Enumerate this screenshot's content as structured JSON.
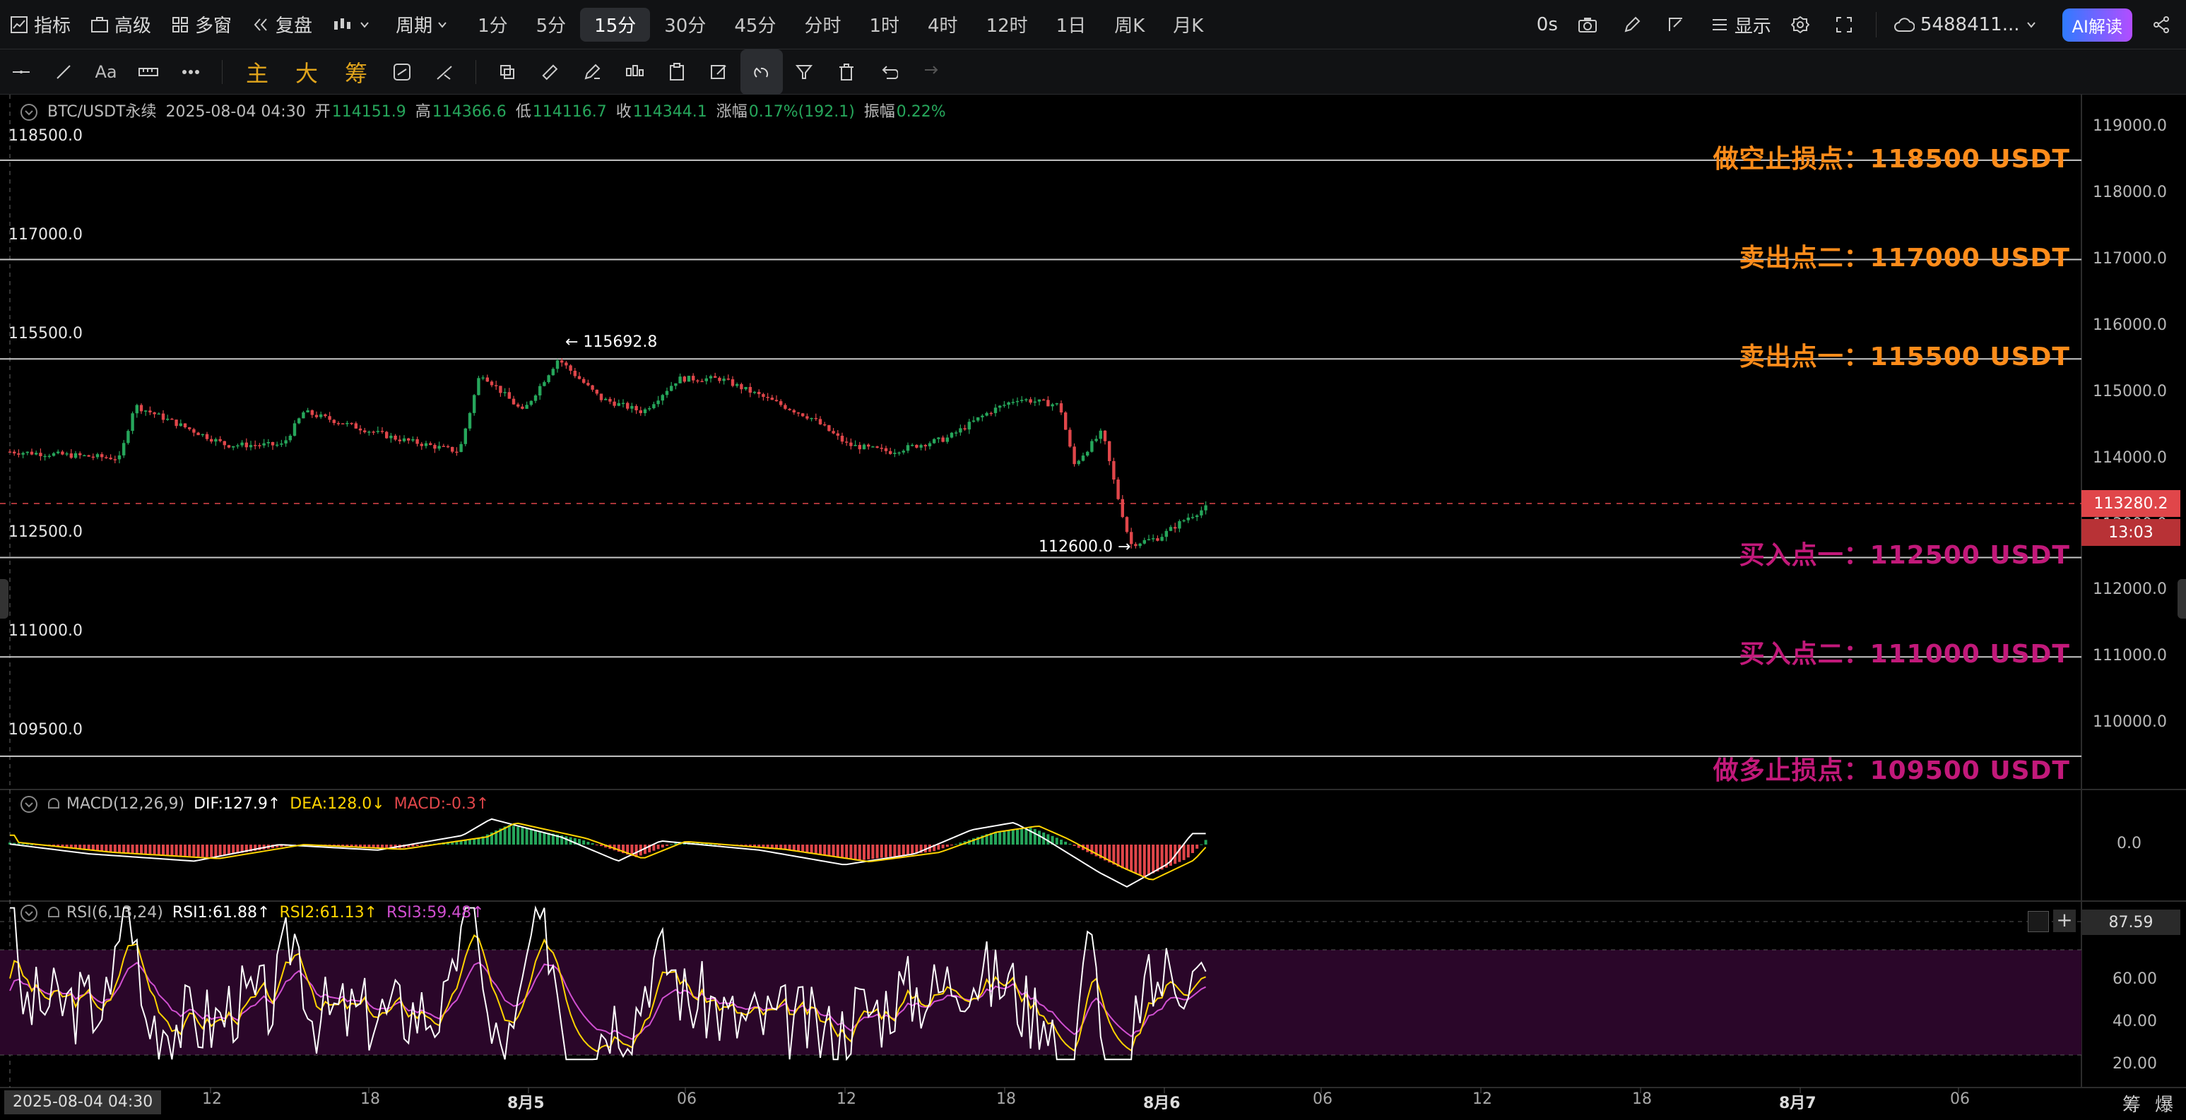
{
  "toolbar": {
    "indicator": "指标",
    "advanced": "高级",
    "multi_window": "多窗",
    "replay": "复盘",
    "period_label": "周期",
    "periods": [
      "1分",
      "5分",
      "15分",
      "30分",
      "45分",
      "分时",
      "1时",
      "4时",
      "12时",
      "1日",
      "周K",
      "月K"
    ],
    "active_period": "15分",
    "timer": "0s",
    "display": "显示",
    "account": "5488411...",
    "ai": "AI解读"
  },
  "drawbar": {
    "text_tool": "Aa",
    "main": "主",
    "big": "大",
    "chip": "筹"
  },
  "legend": {
    "symbol": "BTC/USDT永续",
    "datetime": "2025-08-04 04:30",
    "open_label": "开",
    "open": "114151.9",
    "high_label": "高",
    "high": "114366.6",
    "low_label": "低",
    "low": "114116.7",
    "close_label": "收",
    "close": "114344.1",
    "change_label": "涨幅",
    "change": "0.17%(192.1)",
    "amp_label": "振幅",
    "amp": "0.22%"
  },
  "levels": [
    {
      "value": "118500.0",
      "tag": "做空止损点：118500 USDT",
      "kind": "orange"
    },
    {
      "value": "117000.0",
      "tag": "卖出点二：117000 USDT",
      "kind": "orange"
    },
    {
      "value": "115500.0",
      "tag": "卖出点一：115500 USDT",
      "kind": "orange"
    },
    {
      "value": "112500.0",
      "tag": "买入点一：112500 USDT",
      "kind": "magenta"
    },
    {
      "value": "111000.0",
      "tag": "买入点二：111000 USDT",
      "kind": "magenta"
    },
    {
      "value": "109500.0",
      "tag": "做多止损点：109500 USDT",
      "kind": "magenta"
    }
  ],
  "annotations": {
    "high": "← 115692.8",
    "low": "112600.0 →"
  },
  "price_axis": [
    "119000.0",
    "118000.0",
    "117000.0",
    "116000.0",
    "115000.0",
    "114000.0",
    "113000.0",
    "112000.0",
    "111000.0",
    "110000.0"
  ],
  "current_price": "113280.2",
  "countdown": "13:03",
  "macd": {
    "name": "MACD(12,26,9)",
    "dif": "DIF:127.9↑",
    "dea": "DEA:128.0↓",
    "macd": "MACD:-0.3↑",
    "axis": "0.0"
  },
  "rsi": {
    "name": "RSI(6,13,24)",
    "rsi1": "RSI1:61.88↑",
    "rsi2": "RSI2:61.13↑",
    "rsi3": "RSI3:59.48↑",
    "axis": [
      "87.59",
      "60.00",
      "40.00",
      "20.00"
    ]
  },
  "xaxis": {
    "cursor": "2025-08-04 04:30",
    "labels": [
      "12",
      "18",
      "8月5",
      "06",
      "12",
      "18",
      "8月6",
      "06",
      "12",
      "18",
      "8月7",
      "06"
    ]
  },
  "footer": {
    "chip": "筹",
    "burst": "爆"
  },
  "colors": {
    "up": "#26a65b",
    "down": "#e0464a",
    "orange": "#ff8c1a",
    "magenta": "#c2197a",
    "dif": "#ffffff",
    "dea": "#ffd400",
    "rsi1": "#ffffff",
    "rsi2": "#ffd400",
    "rsi3": "#d04fd0"
  }
}
